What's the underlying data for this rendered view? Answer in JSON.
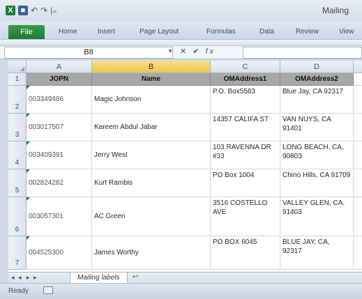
{
  "titlebar": {
    "title": "Mailing",
    "undo_glyph": "↶",
    "redo_glyph": "↷",
    "customize_glyph": "|₌",
    "app_icon": "X",
    "save_icon": "■"
  },
  "ribbon": {
    "tabs": [
      "File",
      "Home",
      "Insert",
      "Page Layout",
      "Formulas",
      "Data",
      "Review",
      "View"
    ]
  },
  "formula_bar": {
    "name_box": "B8",
    "dropdown_glyph": "▾",
    "cancel_glyph": "✕",
    "enter_glyph": "✔",
    "fx_label": "fx",
    "formula_value": ""
  },
  "grid": {
    "corner_glyph": "◢",
    "columns": [
      "A",
      "B",
      "C",
      "D"
    ],
    "selected_column": "B",
    "row_numbers": [
      "1",
      "2",
      "3",
      "4",
      "5",
      "6",
      "7"
    ],
    "headers": [
      "JOPN",
      "Name",
      "OMAddress1",
      "OMAddress2"
    ],
    "rows": [
      [
        "003349486",
        "Magic Johnson",
        "P.O. Box5583",
        "Blue Jay, CA 92317"
      ],
      [
        "003017507",
        "Kareem Abdul Jabar",
        "14357 CALIFA ST",
        "VAN NUYS, CA 91401"
      ],
      [
        "003409391",
        "Jerry West",
        "103 RAVENNA DR #33",
        "LONG BEACH, CA, 90803"
      ],
      [
        "002824282",
        "Kurt Rambis",
        "PO Box 1004",
        "Chino Hills, CA 91709"
      ],
      [
        "003057301",
        "AC Green",
        "3516 COSTELLO AVE",
        "VALLEY GLEN, CA, 91403"
      ],
      [
        "004525300",
        "James Worthy",
        "PO BOX 6045",
        "BLUE JAY, CA, 92317"
      ]
    ]
  },
  "sheets": {
    "nav_first": "◂",
    "nav_prev": "◂",
    "nav_next": "▸",
    "nav_last": "▸",
    "active_sheet": "Mailing labels",
    "new_sheet_glyph": "↩"
  },
  "status": {
    "mode": "Ready"
  },
  "colors": {
    "file_tab": "#1f7a35",
    "selected_column_header": "#f0c64d",
    "header_row_fill": "#a7a7a7"
  }
}
